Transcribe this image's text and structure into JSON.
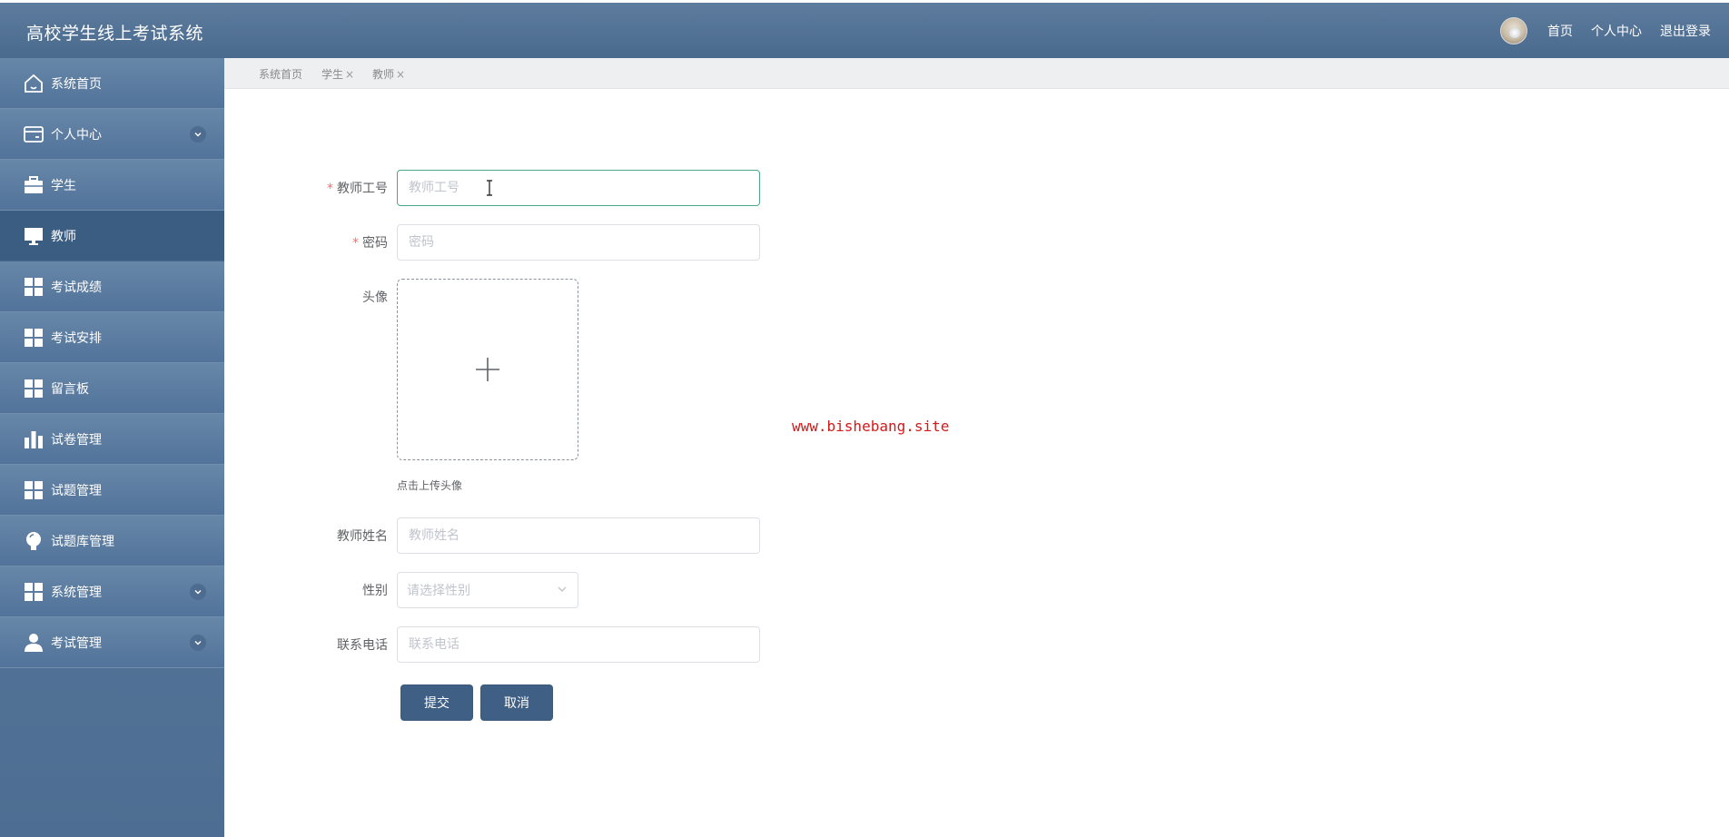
{
  "app": {
    "title": "高校学生线上考试系统"
  },
  "header": {
    "links": [
      "首页",
      "个人中心",
      "退出登录"
    ]
  },
  "sidebar": {
    "items": [
      {
        "label": "系统首页",
        "icon": "home-icon",
        "expandable": false,
        "active": false
      },
      {
        "label": "个人中心",
        "icon": "card-icon",
        "expandable": true,
        "active": false
      },
      {
        "label": "学生",
        "icon": "briefcase-icon",
        "expandable": false,
        "active": false
      },
      {
        "label": "教师",
        "icon": "monitor-icon",
        "expandable": false,
        "active": true
      },
      {
        "label": "考试成绩",
        "icon": "grid-icon",
        "expandable": false,
        "active": false
      },
      {
        "label": "考试安排",
        "icon": "grid-icon",
        "expandable": false,
        "active": false
      },
      {
        "label": "留言板",
        "icon": "grid-icon",
        "expandable": false,
        "active": false
      },
      {
        "label": "试卷管理",
        "icon": "bar-chart-icon",
        "expandable": false,
        "active": false
      },
      {
        "label": "试题管理",
        "icon": "grid-icon",
        "expandable": false,
        "active": false
      },
      {
        "label": "试题库管理",
        "icon": "bulb-icon",
        "expandable": false,
        "active": false
      },
      {
        "label": "系统管理",
        "icon": "grid-icon",
        "expandable": true,
        "active": false
      },
      {
        "label": "考试管理",
        "icon": "user-icon",
        "expandable": true,
        "active": false
      }
    ]
  },
  "tabs": [
    {
      "label": "系统首页",
      "closable": false
    },
    {
      "label": "学生",
      "closable": true
    },
    {
      "label": "教师",
      "closable": true
    }
  ],
  "tab_close": "×",
  "form": {
    "teacher_no": {
      "label": "教师工号",
      "required_mark": "*",
      "placeholder": "教师工号",
      "value": ""
    },
    "password": {
      "label": "密码",
      "required_mark": "*",
      "placeholder": "密码",
      "value": ""
    },
    "avatar": {
      "label": "头像",
      "tip": "点击上传头像"
    },
    "teacher_name": {
      "label": "教师姓名",
      "placeholder": "教师姓名",
      "value": ""
    },
    "gender": {
      "label": "性别",
      "placeholder": "请选择性别"
    },
    "phone": {
      "label": "联系电话",
      "placeholder": "联系电话",
      "value": ""
    },
    "submit_label": "提交",
    "cancel_label": "取消"
  },
  "watermark": "www.bishebang.site",
  "colors": {
    "header": "#52729a",
    "sidebar": "#5a7a9d",
    "active_item": "#3c5d82",
    "button": "#3f5f84",
    "focus_border": "#4aa88a",
    "watermark": "#d11a1a"
  }
}
